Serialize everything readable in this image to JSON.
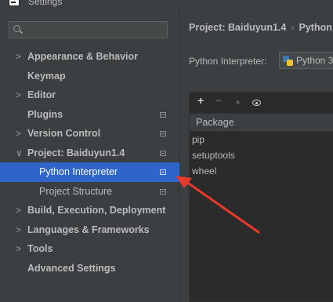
{
  "window": {
    "title": "Settings"
  },
  "search": {
    "placeholder": "",
    "value": ""
  },
  "sidebar": {
    "items": [
      {
        "label": "Appearance & Behavior",
        "arrow": ">",
        "icon": false
      },
      {
        "label": "Keymap",
        "arrow": "",
        "icon": false
      },
      {
        "label": "Editor",
        "arrow": ">",
        "icon": false
      },
      {
        "label": "Plugins",
        "arrow": "",
        "icon": true
      },
      {
        "label": "Version Control",
        "arrow": ">",
        "icon": true
      },
      {
        "label": "Project: Baiduyun1.4",
        "arrow": "∨",
        "icon": true
      },
      {
        "label": "Python Interpreter",
        "arrow": "",
        "icon": true,
        "selected": true
      },
      {
        "label": "Project Structure",
        "arrow": "",
        "icon": true
      },
      {
        "label": "Build, Execution, Deployment",
        "arrow": ">",
        "icon": false
      },
      {
        "label": "Languages & Frameworks",
        "arrow": ">",
        "icon": false
      },
      {
        "label": "Tools",
        "arrow": ">",
        "icon": false
      },
      {
        "label": "Advanced Settings",
        "arrow": "",
        "icon": false
      }
    ]
  },
  "main": {
    "breadcrumb": {
      "project": "Project: Baiduyun1.4",
      "separator": "›",
      "page": "Python"
    },
    "interpreter_label": "Python Interpreter:",
    "interpreter_value": "Python 3"
  },
  "packages": {
    "header": "Package",
    "rows": [
      "pip",
      "setuptools",
      "wheel"
    ]
  },
  "colors": {
    "background": "#3c3f41",
    "selection": "#2f65ca",
    "annotation_arrow": "#e8392d"
  }
}
